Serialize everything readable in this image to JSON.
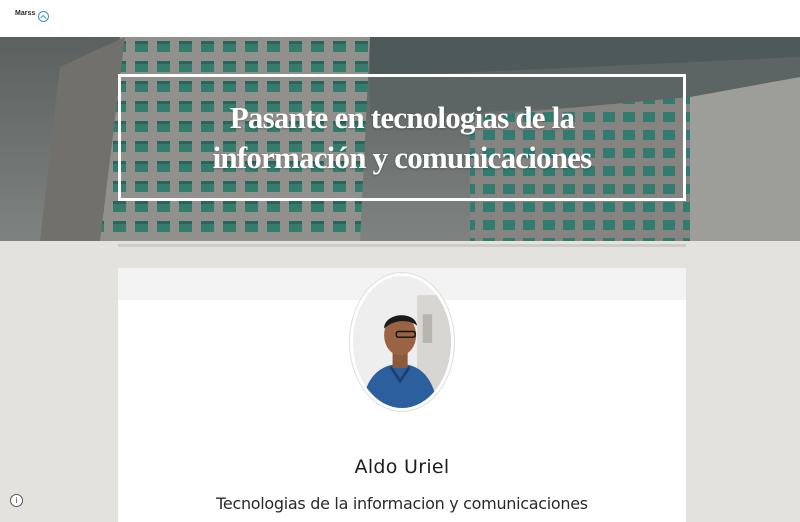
{
  "header": {
    "logo_text": "Marss",
    "logo_icon": "house-circle-icon"
  },
  "hero": {
    "title": "Pasante en tecnologias de la información y comunicaciones",
    "background": "office-buildings-photo"
  },
  "profile": {
    "name": "Aldo Uriel",
    "role": "Tecnologias de la informacion y comunicaciones",
    "avatar": "profile-photo"
  },
  "footer": {
    "info_icon": "info-icon",
    "info_label": "i"
  },
  "colors": {
    "page_background": "#e3e2df",
    "topbar": "#ffffff",
    "accent": "#3d8fd9",
    "building_glass": "#3aa38f"
  }
}
